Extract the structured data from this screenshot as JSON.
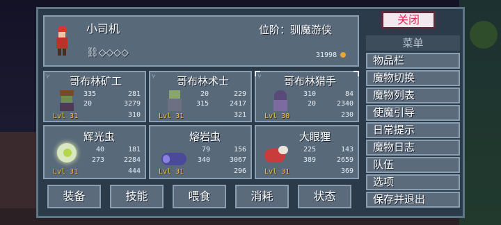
{
  "player": {
    "name": "小司机",
    "rank_label": "位阶：驯魔游侠",
    "gold": "31998",
    "key_glyphs": "⛓◇◇◇◇"
  },
  "close_label": "关闭",
  "menu": {
    "title": "菜单",
    "items": [
      "物品栏",
      "魔物切换",
      "魔物列表",
      "使魔引导",
      "日常提示",
      "魔物日志",
      "队伍",
      "选项",
      "保存并退出"
    ]
  },
  "monsters": [
    {
      "name": "哥布林矿工",
      "level": "Lvl 31",
      "atk": "335",
      "def": "20",
      "mp": "315",
      "hp": "281",
      "hp2": "3279",
      "food": "310"
    },
    {
      "name": "哥布林术士",
      "level": "Lvl 31",
      "atk": "20",
      "def": "315",
      "mp": "",
      "hp": "229",
      "hp2": "2417",
      "food": "321"
    },
    {
      "name": "哥布林猎手",
      "level": "Lvl 30",
      "atk": "310",
      "def": "20",
      "mp": "",
      "hp": "84",
      "hp2": "2340",
      "food": "230"
    },
    {
      "name": "辉光虫",
      "level": "Lvl 31",
      "atk": "40",
      "def": "273",
      "mp": "",
      "hp": "181",
      "hp2": "2284",
      "food": "444"
    },
    {
      "name": "熔岩虫",
      "level": "Lvl 31",
      "atk": "79",
      "def": "340",
      "mp": "",
      "hp": "156",
      "hp2": "3067",
      "food": "296"
    },
    {
      "name": "大眼狸",
      "level": "Lvl 31",
      "atk": "225",
      "def": "389",
      "mp": "",
      "hp": "143",
      "hp2": "2659",
      "food": "369"
    }
  ],
  "actions": [
    "装备",
    "技能",
    "喂食",
    "消耗",
    "状态"
  ],
  "colors": {
    "accent_gold": "#f3c43a",
    "close_text": "#d62c55",
    "panel": "#58697a"
  }
}
